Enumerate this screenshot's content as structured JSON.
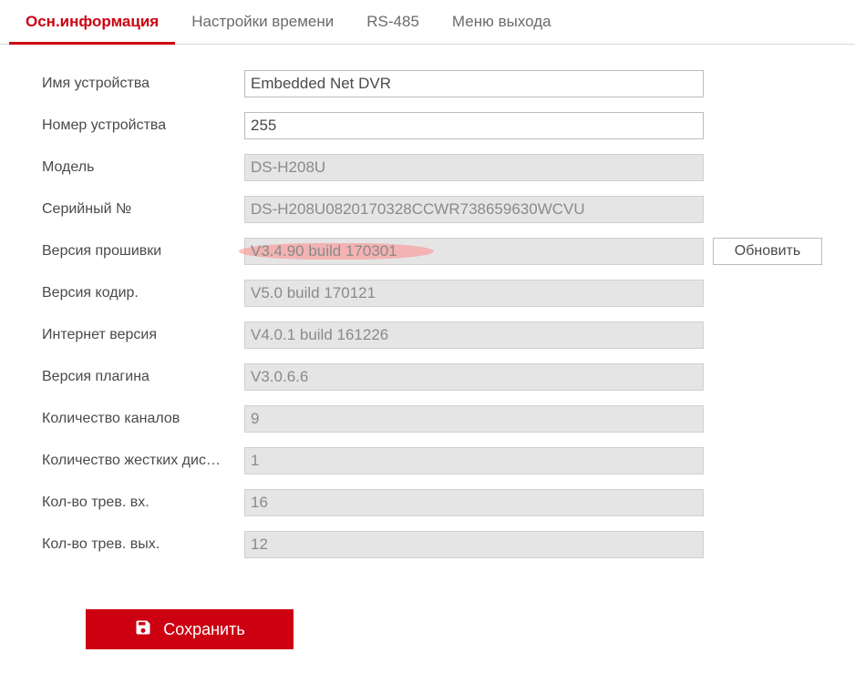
{
  "tabs": {
    "t0": "Осн.информация",
    "t1": "Настройки времени",
    "t2": "RS-485",
    "t3": "Меню выхода"
  },
  "labels": {
    "device_name": "Имя устройства",
    "device_no": "Номер устройства",
    "model": "Модель",
    "serial": "Серийный №",
    "firmware": "Версия прошивки",
    "encoding": "Версия кодир.",
    "web": "Интернет версия",
    "plugin": "Версия плагина",
    "channels": "Количество каналов",
    "hdds": "Количество жестких дис…",
    "alarm_in": "Кол-во трев. вх.",
    "alarm_out": "Кол-во трев. вых."
  },
  "values": {
    "device_name": "Embedded Net DVR",
    "device_no": "255",
    "model": "DS-H208U",
    "serial": "DS-H208U0820170328CCWR738659630WCVU",
    "firmware": "V3.4.90 build 170301",
    "encoding": "V5.0 build 170121",
    "web": "V4.0.1 build 161226",
    "plugin": "V3.0.6.6",
    "channels": "9",
    "hdds": "1",
    "alarm_in": "16",
    "alarm_out": "12"
  },
  "buttons": {
    "update": "Обновить",
    "save": "Сохранить"
  }
}
